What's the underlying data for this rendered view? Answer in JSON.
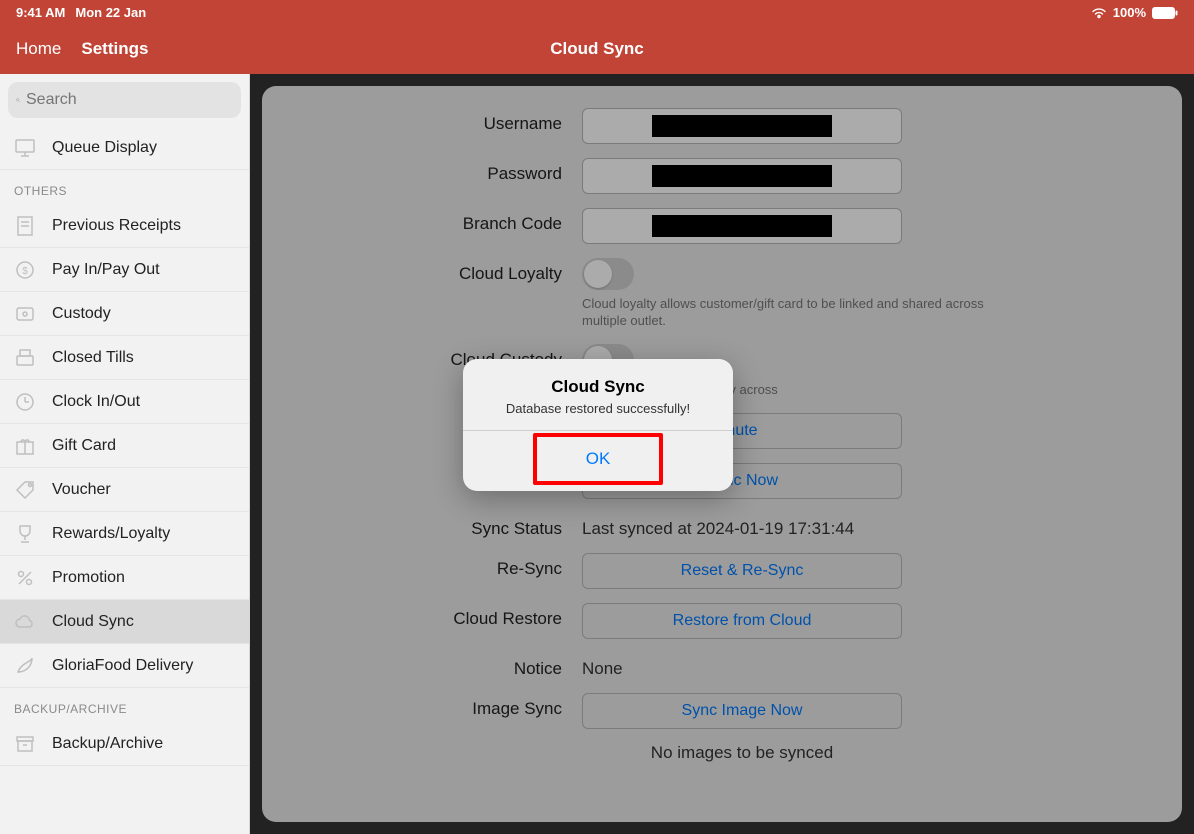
{
  "statusbar": {
    "time": "9:41 AM",
    "date": "Mon 22 Jan",
    "battery": "100%"
  },
  "nav": {
    "home": "Home",
    "settings": "Settings",
    "title": "Cloud Sync"
  },
  "search": {
    "placeholder": "Search"
  },
  "sidebar": {
    "top_items": [
      {
        "label": "Queue Display"
      }
    ],
    "others_header": "OTHERS",
    "others": [
      {
        "label": "Previous Receipts"
      },
      {
        "label": "Pay In/Pay Out"
      },
      {
        "label": "Custody"
      },
      {
        "label": "Closed Tills"
      },
      {
        "label": "Clock In/Out"
      },
      {
        "label": "Gift Card"
      },
      {
        "label": "Voucher"
      },
      {
        "label": "Rewards/Loyalty"
      },
      {
        "label": "Promotion"
      },
      {
        "label": "Cloud Sync"
      },
      {
        "label": "GloriaFood Delivery"
      }
    ],
    "backup_header": "BACKUP/ARCHIVE",
    "backup": [
      {
        "label": "Backup/Archive"
      }
    ]
  },
  "form": {
    "username": {
      "label": "Username"
    },
    "password": {
      "label": "Password"
    },
    "branch": {
      "label": "Branch Code"
    },
    "cloud_loyalty": {
      "label": "Cloud Loyalty",
      "hint": "Cloud loyalty allows customer/gift card to be linked and shared across multiple outlet."
    },
    "cloud_custody": {
      "label": "Cloud Custody",
      "hint": "ustomer to access custody across"
    },
    "sync_interval_btn": "nute",
    "manual_sync": {
      "btn": "Sync Now"
    },
    "sync_status": {
      "label": "Sync Status",
      "value": "Last synced at 2024-01-19 17:31:44"
    },
    "resync": {
      "label": "Re-Sync",
      "btn": "Reset & Re-Sync"
    },
    "restore": {
      "label": "Cloud Restore",
      "btn": "Restore from Cloud"
    },
    "notice": {
      "label": "Notice",
      "value": "None"
    },
    "image_sync": {
      "label": "Image Sync",
      "btn": "Sync Image Now",
      "status": "No images to be synced"
    }
  },
  "alert": {
    "title": "Cloud Sync",
    "message": "Database restored successfully!",
    "ok": "OK"
  }
}
